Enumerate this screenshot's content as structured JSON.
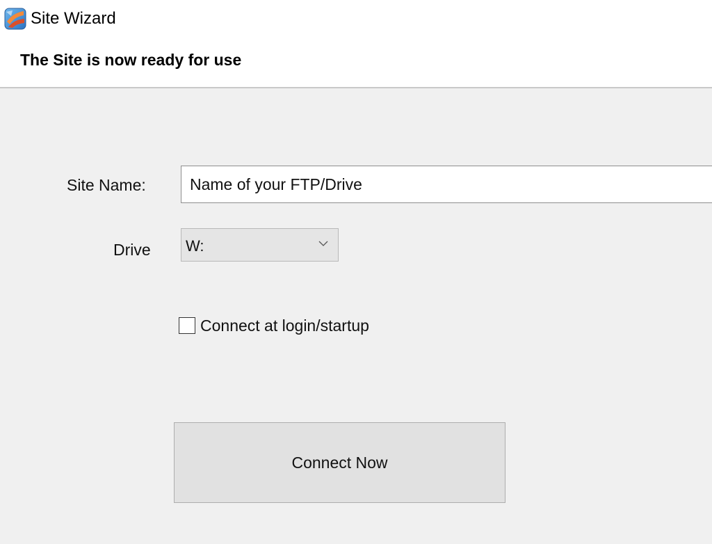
{
  "window": {
    "title": "Site Wizard",
    "icon": "site-wizard-app-icon"
  },
  "header": {
    "title": "The Site is now ready for use"
  },
  "form": {
    "site_name": {
      "label": "Site Name:",
      "value": "Name of your FTP/Drive"
    },
    "drive": {
      "label": "Drive",
      "selected": "W:",
      "icon": "chevron-down-icon"
    },
    "connect_at_login": {
      "label": "Connect at login/startup",
      "checked": false
    },
    "connect_button": {
      "label": "Connect Now"
    }
  },
  "colors": {
    "background": "#f0f0f0",
    "header_background": "#ffffff",
    "button_background": "#e1e1e1",
    "dropdown_background": "#e5e5e5"
  }
}
